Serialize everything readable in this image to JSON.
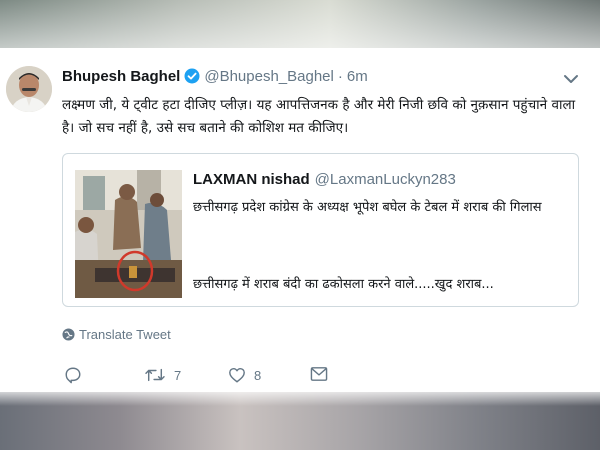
{
  "tweet": {
    "author_name": "Bhupesh Baghel",
    "author_handle": "@Bhupesh_Baghel",
    "separator": "·",
    "time": "6m",
    "text": "लक्ष्मण जी, ये ट्वीट हटा दीजिए प्लीज़। यह आपत्तिजनक है और मेरी निजी छवि को नुक़सान पहुंचाने वाला है। जो सच नहीं है, उसे सच बताने की कोशिश मत कीजिए।",
    "translate_label": "Translate Tweet",
    "retweet_count": "7",
    "like_count": "8"
  },
  "quoted": {
    "author_name": "LAXMAN nishad",
    "author_handle": "@LaxmanLuckyn283",
    "text_line1": "छत्तीसगढ़ प्रदेश कांग्रेस के अध्यक्ष भूपेश बघेल के टेबल में शराब की गिलास",
    "text_line2": "छत्तीसगढ़ में शराब बंदी का ढकोसला करने वाले.....खुद शराब..."
  },
  "colors": {
    "verified_blue": "#1da1f2",
    "secondary_text": "#657786",
    "highlight_circle": "#d0392b"
  },
  "icons": [
    "verified-badge-icon",
    "chevron-down-icon",
    "globe-icon",
    "reply-icon",
    "retweet-icon",
    "like-icon",
    "message-icon"
  ]
}
